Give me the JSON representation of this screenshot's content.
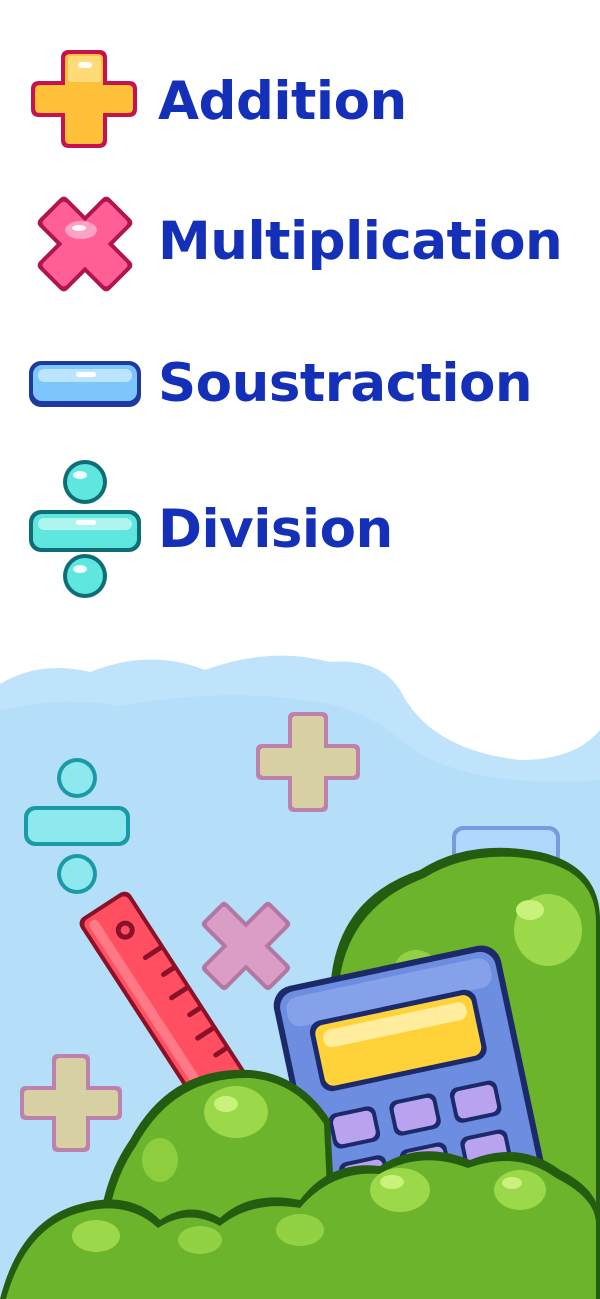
{
  "operations": [
    {
      "label": "Addition",
      "icon": "plus-icon",
      "color": "#ffc13a"
    },
    {
      "label": "Multiplication",
      "icon": "multiply-icon",
      "color": "#ff5f95"
    },
    {
      "label": "Soustraction",
      "icon": "minus-icon",
      "color": "#7cc6fb"
    },
    {
      "label": "Division",
      "icon": "divide-icon",
      "color": "#5fe6df"
    }
  ],
  "colors": {
    "label_text": "#1530b8",
    "sky": "#bfe3fb",
    "bush": "#6cb42c",
    "calculator": "#6d8de0",
    "calculator_screen": "#ffd23a",
    "ruler": "#ff4f61"
  }
}
